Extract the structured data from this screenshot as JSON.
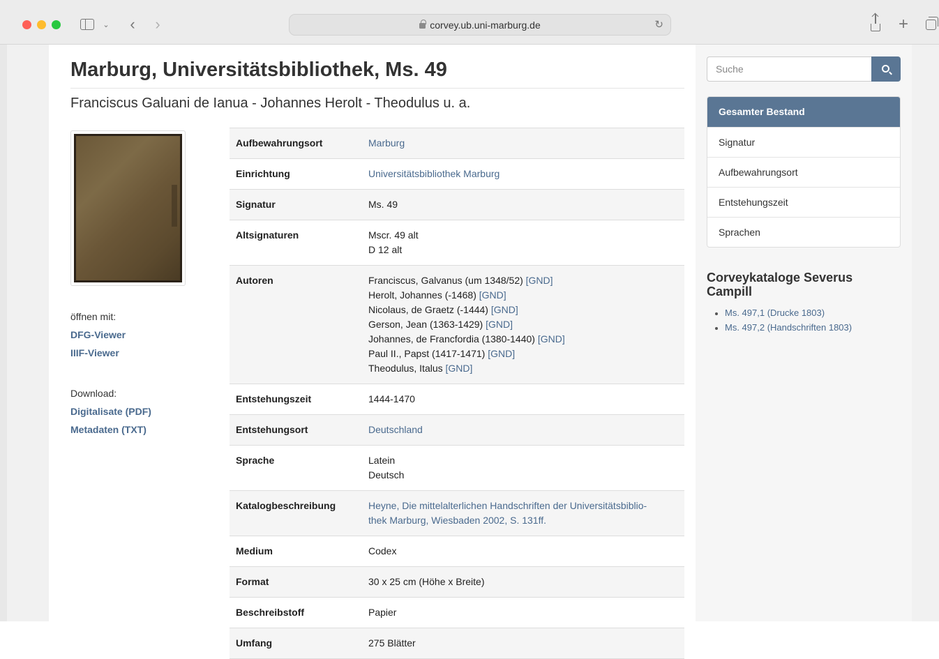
{
  "browser": {
    "url": "corvey.ub.uni-marburg.de"
  },
  "page": {
    "title": "Marburg, Universitätsbibliothek, Ms. 49",
    "subtitle": "Franciscus Galuani de Ianua - Johannes Herolt - Theodulus u. a."
  },
  "sidebar_links": {
    "open_label": "öffnen mit:",
    "dfg_viewer": "DFG-Viewer",
    "iiif_viewer": "IIIF-Viewer",
    "download_label": "Download:",
    "pdf": "Digitalisate (PDF)",
    "txt": "Metadaten (TXT)"
  },
  "meta": [
    {
      "key": "Aufbewahrungsort",
      "lines": [
        {
          "text": "Marburg",
          "link": true
        }
      ]
    },
    {
      "key": "Einrichtung",
      "lines": [
        {
          "text": "Universitätsbibliothek Marburg",
          "link": true
        }
      ]
    },
    {
      "key": "Signatur",
      "lines": [
        {
          "text": "Ms. 49"
        }
      ]
    },
    {
      "key": "Altsignaturen",
      "lines": [
        {
          "text": "Mscr. 49 alt"
        },
        {
          "text": "D 12 alt"
        }
      ]
    },
    {
      "key": "Autoren",
      "lines": [
        {
          "text": "Franciscus, Galvanus (um 1348/52)",
          "gnd": "[GND]"
        },
        {
          "text": "Herolt, Johannes (-1468)",
          "gnd": "[GND]"
        },
        {
          "text": "Nicolaus, de Graetz (-1444)",
          "gnd": "[GND]"
        },
        {
          "text": "Gerson, Jean (1363-1429)",
          "gnd": "[GND]"
        },
        {
          "text": "Johannes, de Francfordia (1380-1440)",
          "gnd": "[GND]"
        },
        {
          "text": "Paul II., Papst (1417-1471)",
          "gnd": "[GND]"
        },
        {
          "text": "Theodulus, Italus",
          "gnd": "[GND]"
        }
      ]
    },
    {
      "key": "Entstehungszeit",
      "lines": [
        {
          "text": "1444-1470"
        }
      ]
    },
    {
      "key": "Entstehungsort",
      "lines": [
        {
          "text": "Deutschland",
          "link": true
        }
      ]
    },
    {
      "key": "Sprache",
      "lines": [
        {
          "text": "Latein"
        },
        {
          "text": "Deutsch"
        }
      ]
    },
    {
      "key": "Katalogbeschreibung",
      "lines": [
        {
          "text": "Heyne, Die mittelalterlichen Handschriften der Universitätsbiblio-",
          "link": true
        },
        {
          "text": "thek Marburg, Wiesbaden 2002, S. 131ff.",
          "link": true
        }
      ]
    },
    {
      "key": "Medium",
      "lines": [
        {
          "text": "Codex"
        }
      ]
    },
    {
      "key": "Format",
      "lines": [
        {
          "text": "30 x 25 cm (Höhe x Breite)"
        }
      ]
    },
    {
      "key": "Beschreibstoff",
      "lines": [
        {
          "text": "Papier"
        }
      ]
    },
    {
      "key": "Umfang",
      "lines": [
        {
          "text": "275 Blätter"
        }
      ]
    }
  ],
  "right": {
    "search_placeholder": "Suche",
    "nav": [
      "Gesamter Bestand",
      "Signatur",
      "Aufbewahrungsort",
      "Entstehungszeit",
      "Sprachen"
    ],
    "heading": "Corveykataloge Severus Campill",
    "catalogs": [
      "Ms. 497,1 (Drucke 1803)",
      "Ms. 497,2 (Handschriften 1803)"
    ]
  },
  "icons": {
    "lock": "lock-icon",
    "reload": "reload-icon",
    "search": "search-icon"
  }
}
